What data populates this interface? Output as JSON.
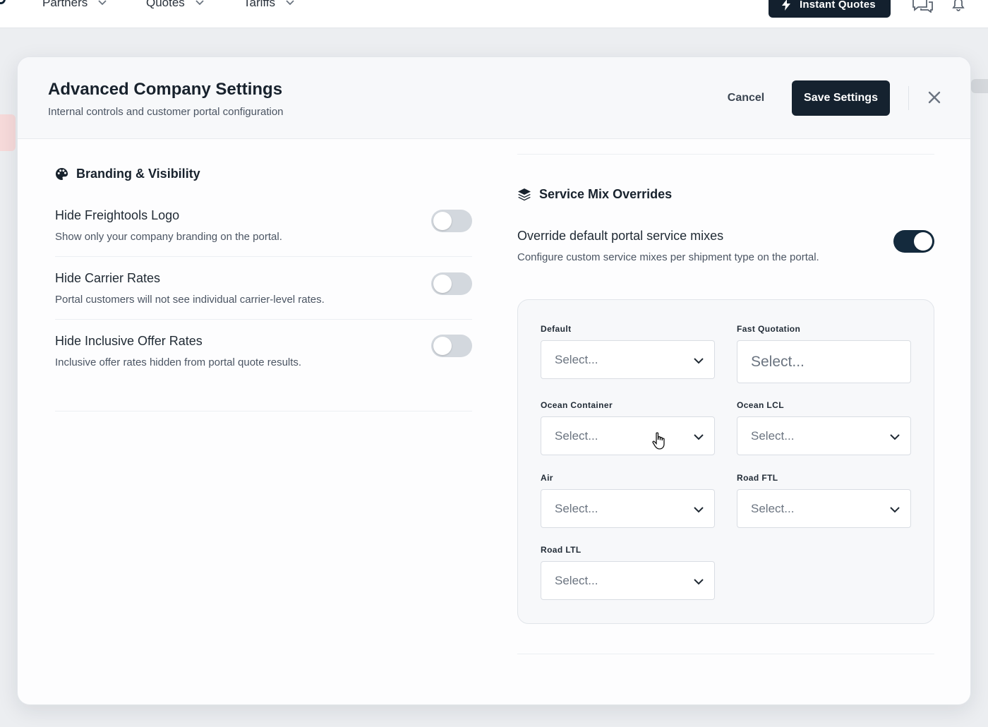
{
  "topnav": {
    "items": [
      {
        "label": "Partners"
      },
      {
        "label": "Quotes"
      },
      {
        "label": "Tariffs"
      }
    ],
    "instant_quotes_label": "Instant Quotes",
    "icons": [
      "bolt-icon",
      "chat-icon",
      "bell-icon"
    ]
  },
  "modal": {
    "title": "Advanced Company Settings",
    "subtitle": "Internal controls and customer portal configuration",
    "cancel_label": "Cancel",
    "save_label": "Save Settings",
    "close_icon": "close-icon"
  },
  "branding": {
    "title": "Branding & Visibility",
    "icon": "palette-icon",
    "settings": [
      {
        "label": "Hide Freightools Logo",
        "description": "Show only your company branding on the portal.",
        "enabled": false
      },
      {
        "label": "Hide Carrier Rates",
        "description": "Portal customers will not see individual carrier-level rates.",
        "enabled": false
      },
      {
        "label": "Hide Inclusive Offer Rates",
        "description": "Inclusive offer rates hidden from portal quote results.",
        "enabled": false
      }
    ]
  },
  "service_mix": {
    "title": "Service Mix Overrides",
    "icon": "layers-icon",
    "override_label": "Override default portal service mixes",
    "override_description": "Configure custom service mixes per shipment type on the portal.",
    "override_enabled": true,
    "fields": [
      {
        "label": "Default",
        "placeholder": "Select..."
      },
      {
        "label": "Fast Quotation",
        "placeholder": "Select..."
      },
      {
        "label": "Ocean Container",
        "placeholder": "Select..."
      },
      {
        "label": "Ocean LCL",
        "placeholder": "Select..."
      },
      {
        "label": "Air",
        "placeholder": "Select..."
      },
      {
        "label": "Road FTL",
        "placeholder": "Select..."
      },
      {
        "label": "Road LTL",
        "placeholder": "Select..."
      }
    ]
  },
  "colors": {
    "primary_dark": "#15222f",
    "toggle_on": "#142a3d",
    "toggle_off": "#d3d8de"
  }
}
